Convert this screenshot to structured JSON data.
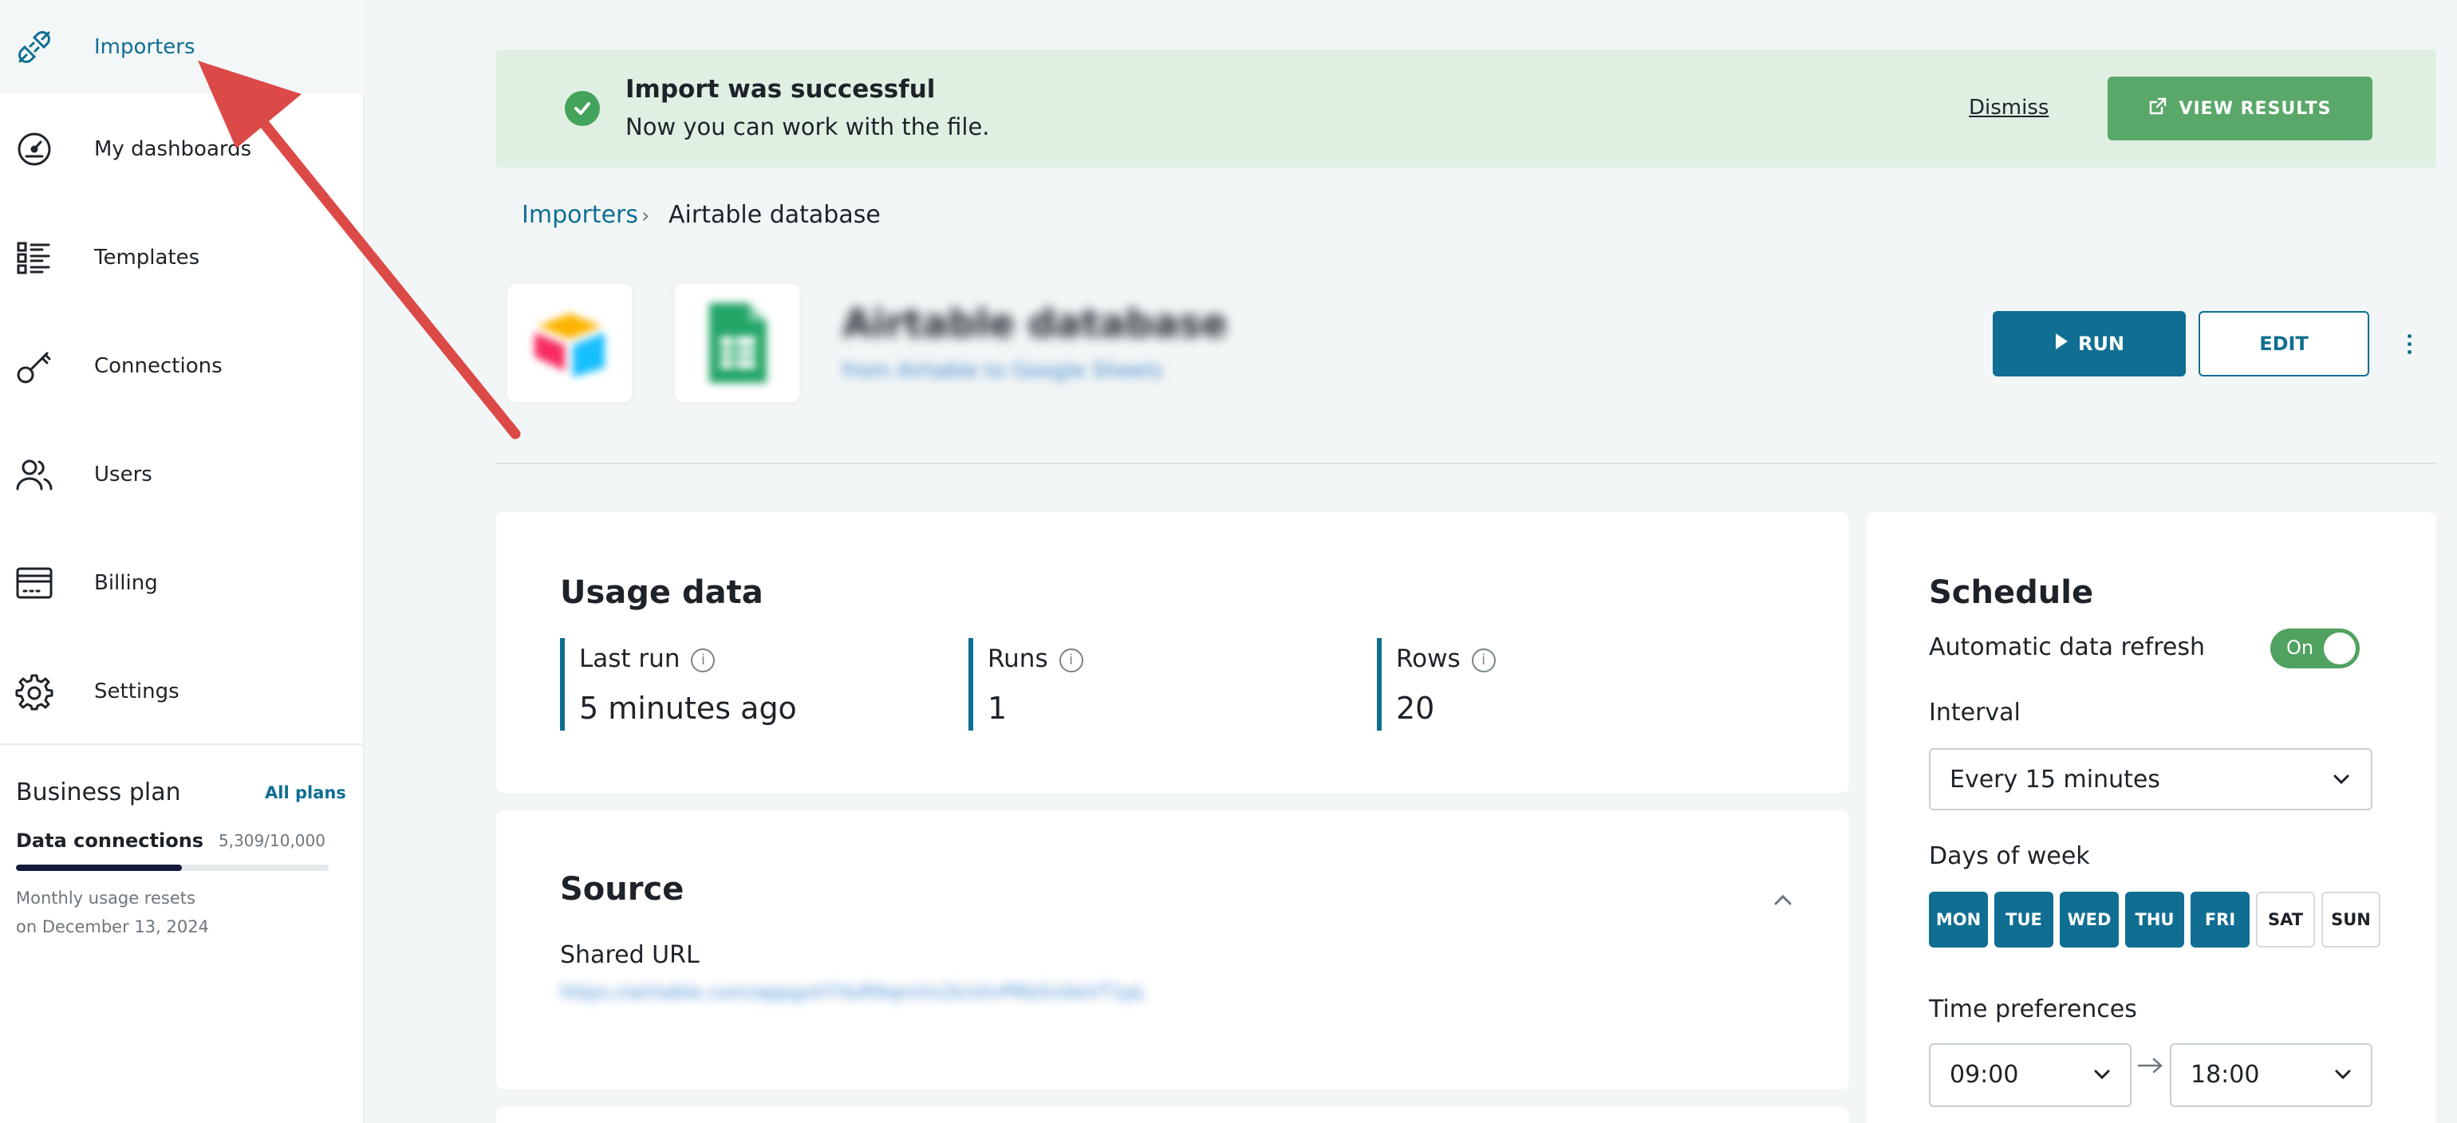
{
  "sidebar": {
    "items": [
      {
        "label": "Importers",
        "icon": "plug-icon",
        "active": true
      },
      {
        "label": "My dashboards",
        "icon": "gauge-icon"
      },
      {
        "label": "Templates",
        "icon": "list-icon"
      },
      {
        "label": "Connections",
        "icon": "key-icon"
      },
      {
        "label": "Users",
        "icon": "users-icon"
      },
      {
        "label": "Billing",
        "icon": "card-icon"
      },
      {
        "label": "Settings",
        "icon": "gear-icon"
      }
    ],
    "plan": {
      "title": "Business plan",
      "all_plans_link": "All plans",
      "connections_label": "Data connections",
      "connections_count": "5,309/10,000",
      "usage_fraction": 0.53,
      "reset_line1": "Monthly usage resets",
      "reset_line2": "on December 13, 2024"
    }
  },
  "banner": {
    "title": "Import was successful",
    "subtitle": "Now you can work with the file.",
    "dismiss": "Dismiss",
    "view_results": "VIEW RESULTS",
    "color": "#dff0e3"
  },
  "breadcrumb": {
    "parent": "Importers",
    "separator": "›",
    "current": "Airtable database"
  },
  "header": {
    "title": "Airtable database",
    "subtitle": "from Airtable to Google Sheets",
    "run_label": "RUN",
    "edit_label": "EDIT"
  },
  "usage": {
    "title": "Usage data",
    "stats": [
      {
        "label": "Last run",
        "value": "5 minutes ago"
      },
      {
        "label": "Runs",
        "value": "1"
      },
      {
        "label": "Rows",
        "value": "20"
      }
    ]
  },
  "source": {
    "title": "Source",
    "shared_url_label": "Shared URL",
    "shared_url_value": "https://airtable.com/appgxhT4zR9qmVx2k/shrPRb5n0eVT1pL"
  },
  "schedule": {
    "title": "Schedule",
    "auto_refresh_label": "Automatic data refresh",
    "auto_refresh_state": "On",
    "interval_label": "Interval",
    "interval_value": "Every 15 minutes",
    "days_label": "Days of week",
    "days": [
      {
        "label": "MON",
        "on": true
      },
      {
        "label": "TUE",
        "on": true
      },
      {
        "label": "WED",
        "on": true
      },
      {
        "label": "THU",
        "on": true
      },
      {
        "label": "FRI",
        "on": true
      },
      {
        "label": "SAT",
        "on": false
      },
      {
        "label": "SUN",
        "on": false
      }
    ],
    "time_label": "Time preferences",
    "time_from": "09:00",
    "time_to": "18:00"
  },
  "colors": {
    "accent": "#0f6e92",
    "success": "#5aa76a",
    "toggle_on": "#4fa25f"
  }
}
